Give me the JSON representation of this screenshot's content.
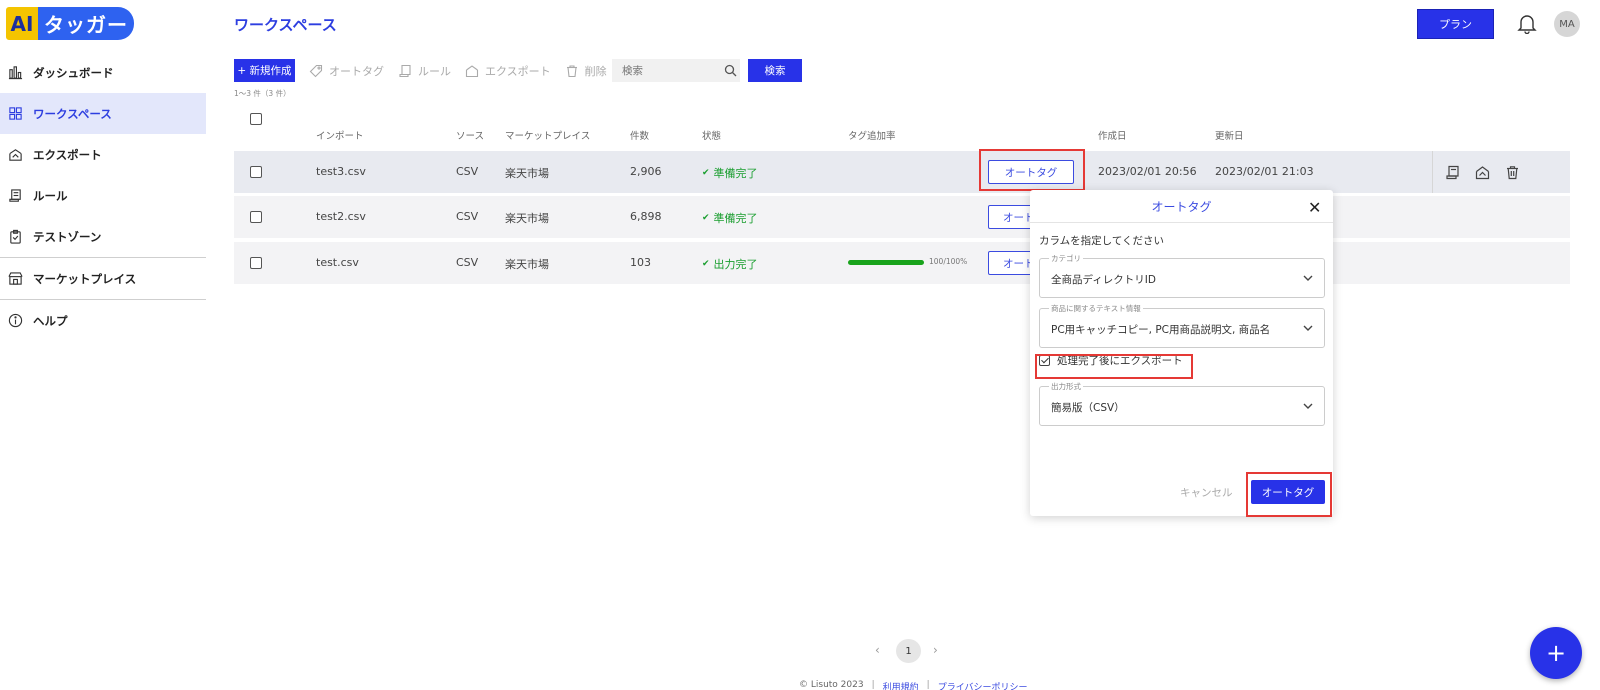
{
  "logo": {
    "ai": "AI",
    "text": "タッガー"
  },
  "header": {
    "title": "ワークスペース",
    "plan_label": "プラン",
    "avatar_initials": "MA"
  },
  "sidebar": {
    "items": [
      {
        "label": "ダッシュボード",
        "icon": "chart-bar-icon"
      },
      {
        "label": "ワークスペース",
        "icon": "grid-icon",
        "active": true
      },
      {
        "label": "エクスポート",
        "icon": "export-icon"
      },
      {
        "label": "ルール",
        "icon": "scroll-icon"
      },
      {
        "label": "テストゾーン",
        "icon": "clipboard-icon"
      },
      {
        "label": "マーケットプレイス",
        "icon": "store-icon"
      },
      {
        "label": "ヘルプ",
        "icon": "info-icon"
      }
    ]
  },
  "toolbar": {
    "new_label": "+ 新規作成",
    "autotag_label": "オートタグ",
    "rule_label": "ルール",
    "export_label": "エクスポート",
    "delete_label": "削除",
    "search_placeholder": "検索",
    "search_button": "検索",
    "count_text": "1～3 件（3 件）"
  },
  "table": {
    "columns": [
      "インポート",
      "ソース",
      "マーケットプレイス",
      "件数",
      "状態",
      "タグ追加率",
      "作成日",
      "更新日"
    ],
    "rows": [
      {
        "name": "test3.csv",
        "source": "CSV",
        "marketplace": "楽天市場",
        "count": "2,906",
        "status": "準備完了",
        "button": "オートタグ",
        "created": "2023/02/01 20:56",
        "updated": "2023/02/01 21:03"
      },
      {
        "name": "test2.csv",
        "source": "CSV",
        "marketplace": "楽天市場",
        "count": "6,898",
        "status": "準備完了",
        "button": "オート"
      },
      {
        "name": "test.csv",
        "source": "CSV",
        "marketplace": "楽天市場",
        "count": "103",
        "status": "出力完了",
        "button": "オート",
        "progress_text": "100/100%",
        "progress": 1.0
      }
    ]
  },
  "dialog": {
    "title": "オートタグ",
    "prompt": "カラムを指定してください",
    "category_label": "カテゴリ",
    "category_value": "全商品ディレクトリID",
    "text_label": "商品に関するテキスト情報",
    "text_value": "PC用キャッチコピー, PC用商品説明文, 商品名",
    "export_check_label": "処理完了後にエクスポート",
    "output_label": "出力形式",
    "output_value": "簡易版（CSV）",
    "cancel_label": "キャンセル",
    "ok_label": "オートタグ"
  },
  "pagination": {
    "current": "1"
  },
  "footer": {
    "copyright": "© Lisuto 2023",
    "terms": "利用規約",
    "privacy": "プライバシーポリシー"
  },
  "colors": {
    "primary": "#2832e8",
    "accent_text": "#2d3ee0",
    "success": "#1a9e2f",
    "highlight": "#e53935"
  }
}
